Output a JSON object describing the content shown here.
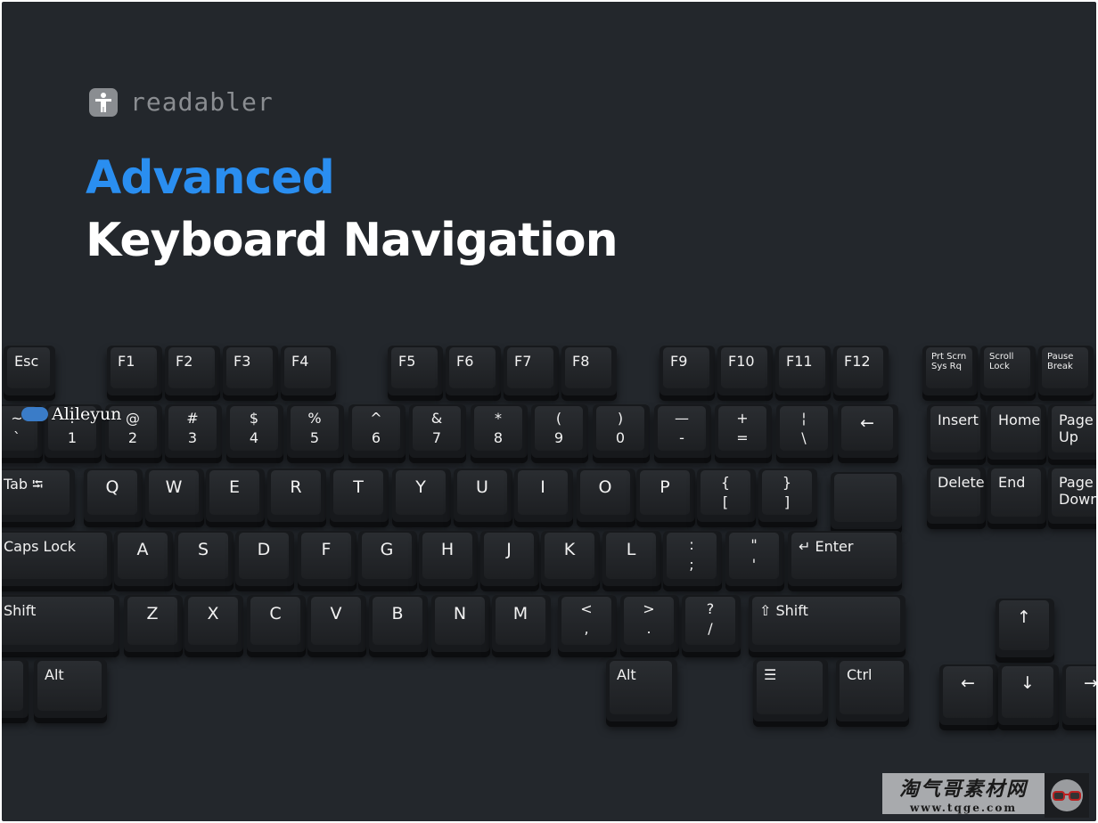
{
  "brand": {
    "name": "readabler",
    "icon": "accessibility-person-icon"
  },
  "headline": {
    "line1": "Advanced",
    "line2": "Keyboard Navigation",
    "accent_color": "#2a8ef0"
  },
  "keyboard": {
    "keys": [
      "Esc",
      "F1",
      "F2",
      "F3",
      "F4",
      "F5",
      "F6",
      "F7",
      "F8",
      "F9",
      "F10",
      "F11",
      "F12",
      "Prt Scrn\nSys Rq",
      "Scroll\nLock",
      "Pause\nBreak",
      "~\n`",
      "!\n1",
      "@\n2",
      "#\n3",
      "$\n4",
      "%\n5",
      "^\n6",
      "&\n7",
      "*\n8",
      "(\n9",
      ")\n0",
      "—\n-",
      "+\n=",
      "¦\n\\",
      "←",
      "Insert",
      "Home",
      "Page\nUp",
      "Tab ⭾",
      "Q",
      "W",
      "E",
      "R",
      "T",
      "Y",
      "U",
      "I",
      "O",
      "P",
      "{\n[",
      "}\n]",
      "",
      "Delete",
      "End",
      "Page\nDown",
      "Caps Lock",
      "A",
      "S",
      "D",
      "F",
      "G",
      "H",
      "J",
      "K",
      "L",
      ":\n;",
      "\"\n'",
      "↵ Enter",
      "Shift",
      "Z",
      "X",
      "C",
      "V",
      "B",
      "N",
      "M",
      "<\n,",
      ">\n.",
      "?\n/",
      "⇧ Shift",
      "↑",
      "",
      "Alt",
      "Alt",
      "☰",
      "Ctrl",
      "←",
      "↓",
      "→"
    ]
  },
  "watermarks": {
    "alileyun": "Alileyun",
    "tqge_cn": "淘气哥素材网",
    "tqge_url": "www.tqge.com"
  }
}
